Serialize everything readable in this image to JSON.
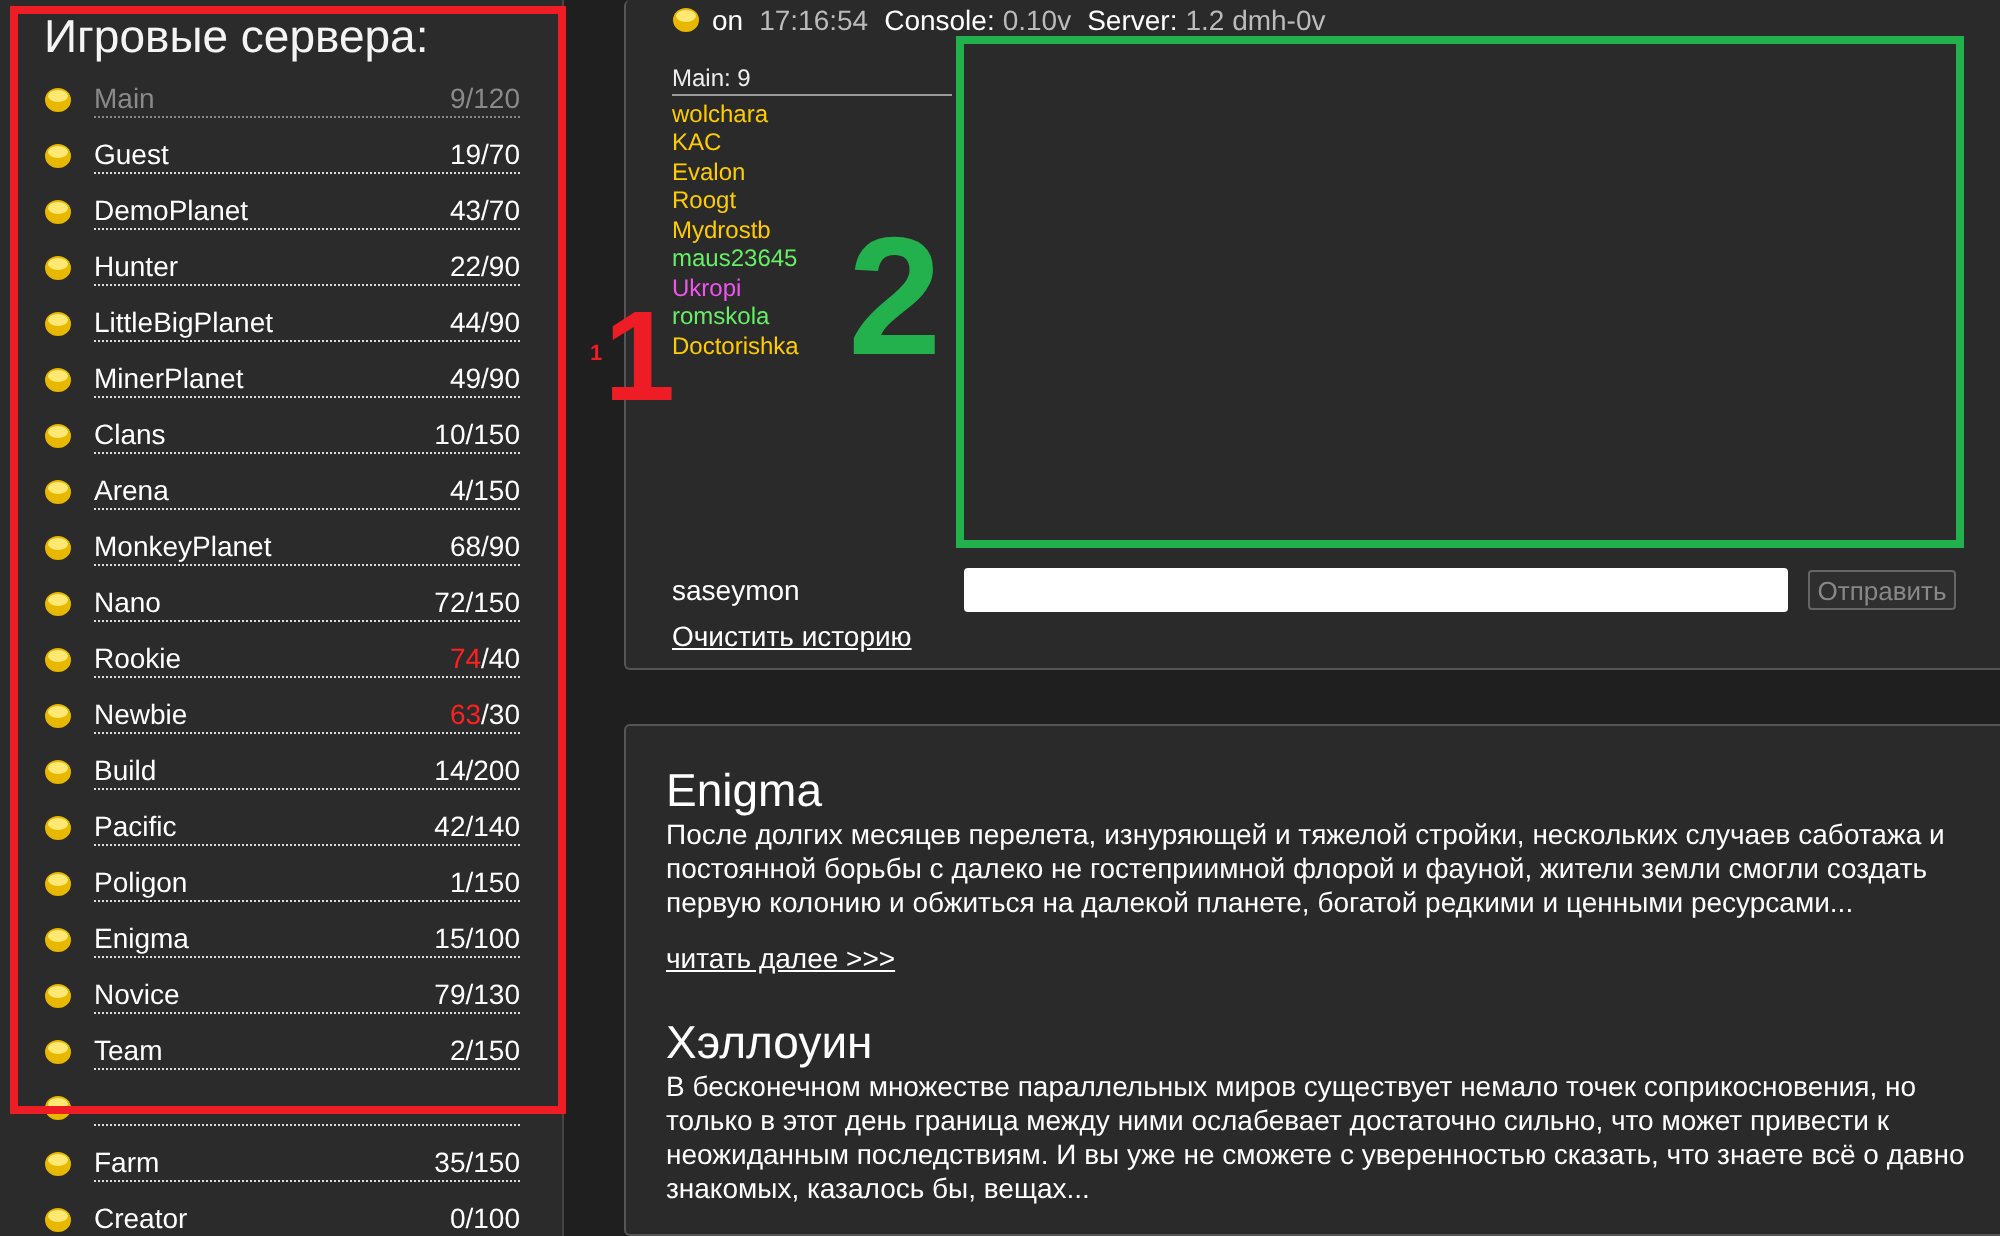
{
  "sidebar": {
    "title": "Игровые сервера:",
    "servers": [
      {
        "name": "Main",
        "online": "9",
        "max": "/120",
        "disabled": true,
        "over": false
      },
      {
        "name": "Guest",
        "online": "19",
        "max": "/70",
        "disabled": false,
        "over": false
      },
      {
        "name": "DemoPlanet",
        "online": "43",
        "max": "/70",
        "disabled": false,
        "over": false
      },
      {
        "name": "Hunter",
        "online": "22",
        "max": "/90",
        "disabled": false,
        "over": false
      },
      {
        "name": "LittleBigPlanet",
        "online": "44",
        "max": "/90",
        "disabled": false,
        "over": false
      },
      {
        "name": "MinerPlanet",
        "online": "49",
        "max": "/90",
        "disabled": false,
        "over": false
      },
      {
        "name": "Clans",
        "online": "10",
        "max": "/150",
        "disabled": false,
        "over": false
      },
      {
        "name": "Arena",
        "online": "4",
        "max": "/150",
        "disabled": false,
        "over": false
      },
      {
        "name": "MonkeyPlanet",
        "online": "68",
        "max": "/90",
        "disabled": false,
        "over": false
      },
      {
        "name": "Nano",
        "online": "72",
        "max": "/150",
        "disabled": false,
        "over": false
      },
      {
        "name": "Rookie",
        "online": "74",
        "max": "/40",
        "disabled": false,
        "over": true
      },
      {
        "name": "Newbie",
        "online": "63",
        "max": "/30",
        "disabled": false,
        "over": true
      },
      {
        "name": "Build",
        "online": "14",
        "max": "/200",
        "disabled": false,
        "over": false
      },
      {
        "name": "Pacific",
        "online": "42",
        "max": "/140",
        "disabled": false,
        "over": false
      },
      {
        "name": "Poligon",
        "online": "1",
        "max": "/150",
        "disabled": false,
        "over": false
      },
      {
        "name": "Enigma",
        "online": "15",
        "max": "/100",
        "disabled": false,
        "over": false
      },
      {
        "name": "Novice",
        "online": "79",
        "max": "/130",
        "disabled": false,
        "over": false
      },
      {
        "name": "Team",
        "online": "2",
        "max": "/150",
        "disabled": false,
        "over": false
      },
      {
        "kind": "covered"
      },
      {
        "name": "Farm",
        "online": "35",
        "max": "/150",
        "disabled": false,
        "over": false
      },
      {
        "name": "Creator",
        "online": "0",
        "max": "/100",
        "disabled": false,
        "over": false
      }
    ]
  },
  "status_bar": {
    "state": "on",
    "time": "17:16:54",
    "console_label": "Console:",
    "console_version": "0.10v",
    "server_label": "Server:",
    "server_version": "1.2 dmh-0v"
  },
  "chat": {
    "users_heading": "Main: 9",
    "users": [
      {
        "name": "wolchara",
        "color": "#ffcc00"
      },
      {
        "name": "KAC",
        "color": "#ffcc00"
      },
      {
        "name": "Evalon",
        "color": "#ffcc00"
      },
      {
        "name": "Roogt",
        "color": "#ffcc00"
      },
      {
        "name": "Mydrostb",
        "color": "#ffcc00"
      },
      {
        "name": "maus23645",
        "color": "#66ee66"
      },
      {
        "name": "Ukropi",
        "color": "#ee55ee"
      },
      {
        "name": "romskola",
        "color": "#66ee66"
      },
      {
        "name": "Doctorishka",
        "color": "#ffcc00"
      }
    ],
    "nickname": "saseymon",
    "send_button": {
      "label": "Отправить",
      "disabled": true
    },
    "clear_link": "Очистить историю"
  },
  "news": [
    {
      "title": "Enigma",
      "text": "После долгих месяцев перелета, изнуряющей и тяжелой стройки, нескольких случаев саботажа и постоянной борьбы с далеко не гостеприимной флорой и фауной, жители земли смогли создать первую колонию и обжиться на далекой планете, богатой редкими и ценными ресурсами...",
      "link": "читать далее >>>"
    },
    {
      "title": "Хэллоуин",
      "text": "В бесконечном множестве параллельных миров существует немало точек соприкосновения, но только в этот день граница между ними ослабевает достаточно сильно, что может привести к неожиданным последствиям. И вы уже не сможете с уверенностью сказать, что знаете всё о давно знакомых, казалось бы, вещах..."
    }
  ],
  "annotations": [
    {
      "kind": "frame",
      "color": "#ee1c24"
    },
    {
      "kind": "small-number",
      "label": "1",
      "color": "#ee1c24"
    },
    {
      "kind": "number",
      "label": "1",
      "color": "#ee1c24"
    },
    {
      "kind": "number",
      "label": "2",
      "color": "#22b14c"
    },
    {
      "kind": "frame",
      "color": "#22b14c"
    }
  ]
}
